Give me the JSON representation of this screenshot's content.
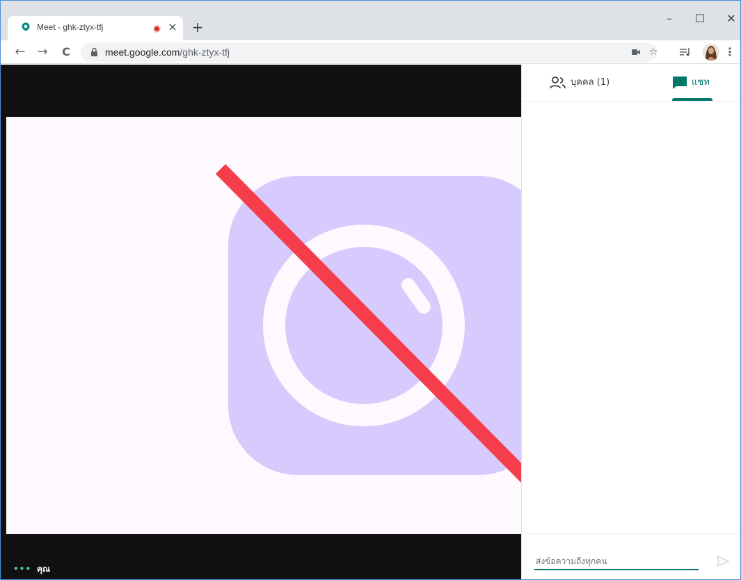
{
  "browser": {
    "tab_title": "Meet - ghk-ztyx-tfj",
    "tab_close": "×",
    "new_tab": "+",
    "url_host": "meet.google.com",
    "url_path": "/ghk-ztyx-tfj"
  },
  "window_controls": {
    "minimize": "–",
    "maximize": "☐",
    "close": "✕"
  },
  "nav": {
    "back": "←",
    "forward": "→",
    "reload": "C"
  },
  "meeting": {
    "self_dots": "•••",
    "self_name": "คุณ"
  },
  "side_panel": {
    "people_tab": "บุคคล (1)",
    "chat_tab": "แชท",
    "chat_placeholder": "ส่งข้อความถึงทุกคน"
  },
  "colors": {
    "accent": "#00796b",
    "slash": "#f53d4b",
    "camera_tint": "#d6cbfc",
    "stage_bg": "#111111"
  }
}
